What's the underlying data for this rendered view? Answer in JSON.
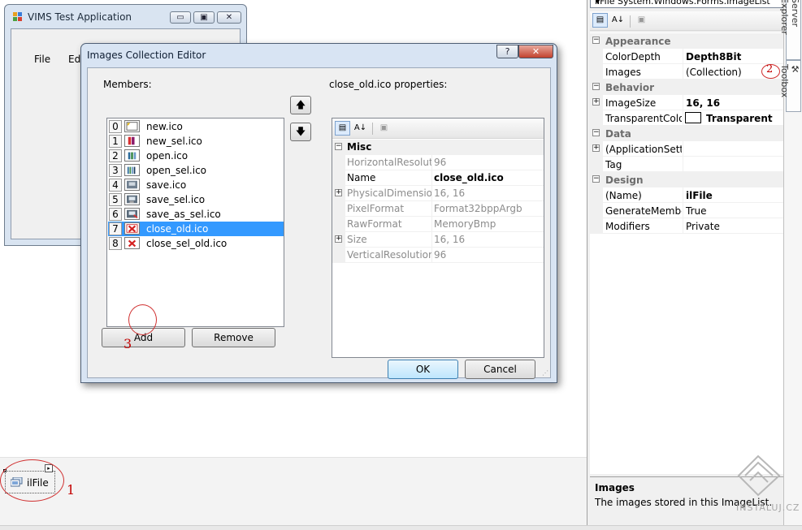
{
  "back_form": {
    "title": "VIMS Test Application",
    "menu": [
      "File",
      "Ed"
    ],
    "caption_buttons": {
      "minimize": "▭",
      "maximize": "▣",
      "close": "✕"
    }
  },
  "dialog": {
    "title": "Images Collection Editor",
    "help_label": "?",
    "close_label": "✕",
    "members_label": "Members:",
    "members": [
      {
        "index": "0",
        "name": "new.ico",
        "icon": "new-file-icon"
      },
      {
        "index": "1",
        "name": "new_sel.ico",
        "icon": "new-sel-icon"
      },
      {
        "index": "2",
        "name": "open.ico",
        "icon": "open-icon"
      },
      {
        "index": "3",
        "name": "open_sel.ico",
        "icon": "open-sel-icon"
      },
      {
        "index": "4",
        "name": "save.ico",
        "icon": "save-icon"
      },
      {
        "index": "5",
        "name": "save_sel.ico",
        "icon": "save-sel-icon"
      },
      {
        "index": "6",
        "name": "save_as_sel.ico",
        "icon": "save-as-icon"
      },
      {
        "index": "7",
        "name": "close_old.ico",
        "icon": "close-old-icon"
      },
      {
        "index": "8",
        "name": "close_sel_old.ico",
        "icon": "close-sel-icon"
      }
    ],
    "selected_index": 7,
    "move_up_label": "🡅",
    "move_down_label": "🡇",
    "add_label": "Add",
    "remove_label": "Remove",
    "properties_label": "close_old.ico properties:",
    "properties": [
      {
        "type": "category",
        "name": "Misc",
        "expander": "⊟"
      },
      {
        "name": "HorizontalResolutic",
        "value": "96",
        "style": "gray"
      },
      {
        "name": "Name",
        "value": "close_old.ico",
        "style": "bold"
      },
      {
        "name": "PhysicalDimension",
        "value": "16, 16",
        "style": "gray",
        "expander": "⊞"
      },
      {
        "name": "PixelFormat",
        "value": "Format32bppArgb",
        "style": "gray"
      },
      {
        "name": "RawFormat",
        "value": "MemoryBmp",
        "style": "gray"
      },
      {
        "name": "Size",
        "value": "16, 16",
        "style": "gray",
        "expander": "⊞"
      },
      {
        "name": "VerticalResolution",
        "value": "96",
        "style": "gray"
      }
    ],
    "ok_label": "OK",
    "cancel_label": "Cancel"
  },
  "component_tray": {
    "component_label": "ilFile"
  },
  "properties_panel": {
    "object_selector": "ilFile System.Windows.Forms.ImageList",
    "dropdown_arrow": "▼",
    "rows": [
      {
        "type": "category",
        "name": "Appearance",
        "expander": "⊟"
      },
      {
        "name": "ColorDepth",
        "value": "Depth8Bit",
        "value_bold": true
      },
      {
        "name": "Images",
        "value": "(Collection)"
      },
      {
        "type": "category",
        "name": "Behavior",
        "expander": "⊟"
      },
      {
        "name": "ImageSize",
        "value": "16, 16",
        "value_bold": true,
        "expander": "⊞"
      },
      {
        "name": "TransparentColor",
        "value": "Transparent",
        "value_bold": true,
        "swatch": "#ffffff"
      },
      {
        "type": "category",
        "name": "Data",
        "expander": "⊟"
      },
      {
        "name": "(ApplicationSettin",
        "value": "",
        "expander": "⊞"
      },
      {
        "name": "Tag",
        "value": ""
      },
      {
        "type": "category",
        "name": "Design",
        "expander": "⊟"
      },
      {
        "name": "(Name)",
        "value": "ilFile",
        "value_bold": true
      },
      {
        "name": "GenerateMember",
        "value": "True"
      },
      {
        "name": "Modifiers",
        "value": "Private"
      }
    ],
    "description_title": "Images",
    "description_text": "The images stored in this ImageList."
  },
  "side_tabs": [
    "Server Explorer",
    "Toolbox"
  ],
  "annotations": {
    "one": "1",
    "two": "2",
    "three": "3"
  },
  "watermark": "INSTALUJ.CZ",
  "colors": {
    "selection": "#3399ff",
    "annotation": "#c30000",
    "window_frame": "#d8e4f3"
  }
}
